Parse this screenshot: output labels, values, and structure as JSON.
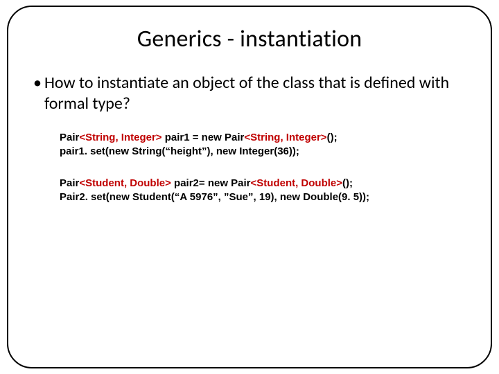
{
  "title": "Generics - instantiation",
  "bullet": "How to instantiate an object of the class that is defined with formal type?",
  "code1": {
    "l1a": "Pair",
    "l1b": "<String, Integer>",
    "l1c": "  pair1 = new Pair",
    "l1d": "<String, Integer>",
    "l1e": "();",
    "l2": "pair1. set(new String(“height”), new Integer(36));"
  },
  "code2": {
    "l1a": "Pair",
    "l1b": "<Student, Double>",
    "l1c": " pair2= new Pair",
    "l1d": "<Student, Double>",
    "l1e": "();",
    "l2": "Pair2. set(new Student(“A 5976”, ”Sue”, 19),  new Double(9. 5));"
  }
}
